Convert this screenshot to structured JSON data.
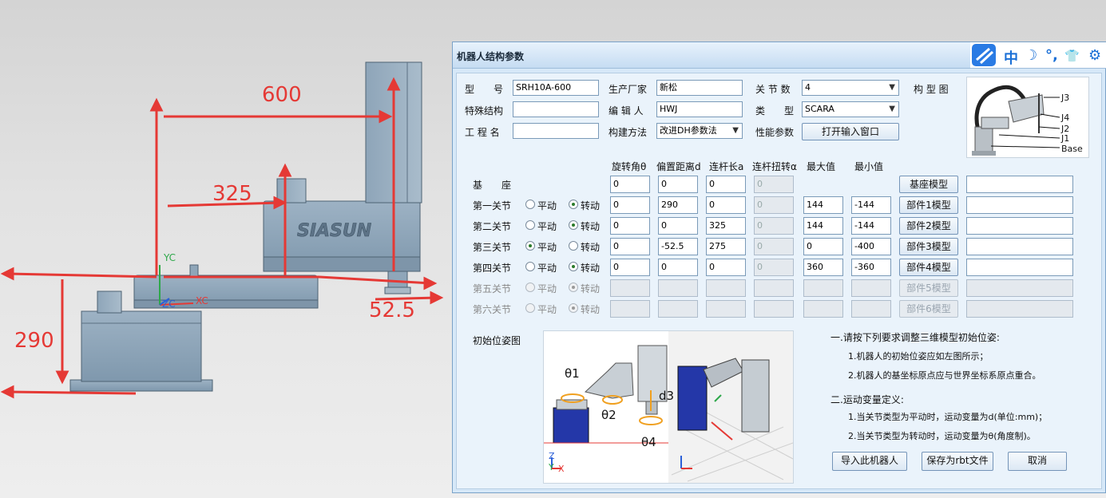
{
  "viewport": {
    "dimensions": {
      "d600": "600",
      "d325": "325",
      "d290": "290",
      "d52": "52.5"
    },
    "axes": {
      "yc": "YC",
      "xc": "XC",
      "zc": "ZC"
    },
    "brand": "SIASUN"
  },
  "dialog": {
    "title": "机器人结构参数",
    "toolbar": {
      "lang": "中",
      "moon": "☽",
      "dots": "°,",
      "shirt": "👕",
      "gear": "⚙"
    },
    "fields": {
      "model_label": "型　　号",
      "model_value": "SRH10A-600",
      "maker_label": "生产厂家",
      "maker_value": "新松",
      "joints_label": "关 节 数",
      "joints_value": "4",
      "diagram_label": "构 型 图",
      "special_label": "特殊结构",
      "special_value": "",
      "editor_label": "编 辑 人",
      "editor_value": "HWJ",
      "type_label": "类　　型",
      "type_value": "SCARA",
      "engineer_label": "工 程 名",
      "engineer_value": "",
      "method_label": "构建方法",
      "method_value": "改进DH参数法",
      "perf_label": "性能参数",
      "open_button": "打开输入窗口"
    },
    "diagram_labels": [
      "J3",
      "J4",
      "J2",
      "J1",
      "Base"
    ],
    "columns": [
      "旋转角θ",
      "偏置距离d",
      "连杆长a",
      "连杆扭转α",
      "最大值",
      "最小值"
    ],
    "mode_labels": {
      "prismatic": "平动",
      "revolute": "转动"
    },
    "rows": [
      {
        "label": "基　　座",
        "mode": null,
        "theta": "0",
        "d": "0",
        "a": "0",
        "alpha": "0",
        "max": null,
        "min": null,
        "button": "基座模型",
        "enabled": true
      },
      {
        "label": "第一关节",
        "mode": "revolute",
        "theta": "0",
        "d": "290",
        "a": "0",
        "alpha": "0",
        "max": "144",
        "min": "-144",
        "button": "部件1模型",
        "enabled": true
      },
      {
        "label": "第二关节",
        "mode": "revolute",
        "theta": "0",
        "d": "0",
        "a": "325",
        "alpha": "0",
        "max": "144",
        "min": "-144",
        "button": "部件2模型",
        "enabled": true
      },
      {
        "label": "第三关节",
        "mode": "prismatic",
        "theta": "0",
        "d": "-52.5",
        "a": "275",
        "alpha": "0",
        "max": "0",
        "min": "-400",
        "button": "部件3模型",
        "enabled": true
      },
      {
        "label": "第四关节",
        "mode": "revolute",
        "theta": "0",
        "d": "0",
        "a": "0",
        "alpha": "0",
        "max": "360",
        "min": "-360",
        "button": "部件4模型",
        "enabled": true
      },
      {
        "label": "第五关节",
        "mode": "revolute",
        "theta": "",
        "d": "",
        "a": "",
        "alpha": "",
        "max": "",
        "min": "",
        "button": "部件5模型",
        "enabled": false
      },
      {
        "label": "第六关节",
        "mode": "revolute",
        "theta": "",
        "d": "",
        "a": "",
        "alpha": "",
        "max": "",
        "min": "",
        "button": "部件6模型",
        "enabled": false
      }
    ],
    "initial_pose_label": "初始位姿图",
    "pose_labels": {
      "t1": "θ1",
      "t2": "θ2",
      "d3": "d3",
      "t4": "θ4",
      "z": "Z",
      "y": "Y",
      "x": "X"
    },
    "notes": {
      "h1": "一.请按下列要求调整三维模型初始位姿:",
      "n1": "1.机器人的初始位姿应如左图所示；",
      "n2": "2.机器人的基坐标原点应与世界坐标系原点重合。",
      "h2": "二.运动变量定义:",
      "n3": "1.当关节类型为平动时，运动变量为d(单位:mm)；",
      "n4": "2.当关节类型为转动时，运动变量为θ(角度制)。"
    },
    "buttons": {
      "import": "导入此机器人",
      "save": "保存为rbt文件",
      "cancel": "取消"
    }
  }
}
